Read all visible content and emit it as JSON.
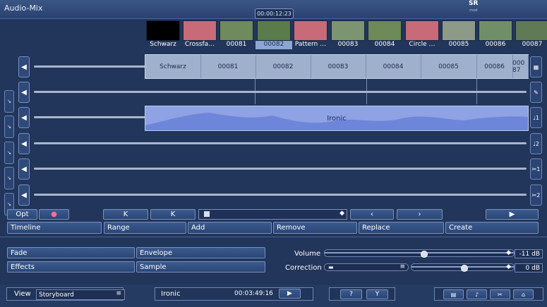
{
  "app": {
    "title": "Audio-Mix",
    "timecode": "00:00:12:23",
    "sr_label": "SR",
    "sr_sub": "mod"
  },
  "thumbnails": [
    {
      "label": "Schwarz",
      "color": "#000000"
    },
    {
      "label": "Crossfa…",
      "color": "#c86a78"
    },
    {
      "label": "00081",
      "color": "#6f8a5c"
    },
    {
      "label": "00082",
      "color": "#5a7b4a",
      "selected": true
    },
    {
      "label": "Pattern …",
      "color": "#c86a78"
    },
    {
      "label": "00083",
      "color": "#7d9470"
    },
    {
      "label": "00084",
      "color": "#6d8a58"
    },
    {
      "label": "Circle …",
      "color": "#c86a78"
    },
    {
      "label": "00085",
      "color": "#8d9a88"
    },
    {
      "label": "00086",
      "color": "#708f69"
    },
    {
      "label": "00087",
      "color": "#5f7a54"
    }
  ],
  "video_track": {
    "segments": [
      "Schwarz",
      "00081",
      "00082",
      "00083",
      "00084",
      "00085",
      "00086",
      "000 87"
    ]
  },
  "audio_clip": {
    "label": "Ironic"
  },
  "left_rows": [
    {
      "side_label": ""
    },
    {
      "side_label": "↘"
    },
    {
      "side_label": "↘"
    },
    {
      "side_label": "↘"
    },
    {
      "side_label": "↘"
    },
    {
      "side_label": "↘"
    }
  ],
  "right_icons": [
    "▦",
    "✎",
    "♩1",
    "♩2",
    "✂1",
    "✂2"
  ],
  "controls": {
    "opt": "Opt",
    "record": "●",
    "first": "K",
    "last": "K",
    "scroll": "◆",
    "prev": "‹",
    "next": "›",
    "play": "▶"
  },
  "edit_bar": [
    "Timeline",
    "Range",
    "Add",
    "Remove",
    "Replace",
    "Create"
  ],
  "panel": {
    "fade": "Fade",
    "envelope": "Envelope",
    "effects": "Effects",
    "sample": "Sample",
    "volume_label": "Volume",
    "volume_value": "-11 dB",
    "volume_fraction": 0.52,
    "correction_label": "Correction",
    "correction_value": "0 dB",
    "correction_fraction": 0.5
  },
  "bottom": {
    "view_label": "View",
    "view_value": "Storyboard",
    "clip_name": "Ironic",
    "clip_time": "00:03:49:16",
    "play": "▶",
    "help": "?",
    "tools": "Y"
  }
}
